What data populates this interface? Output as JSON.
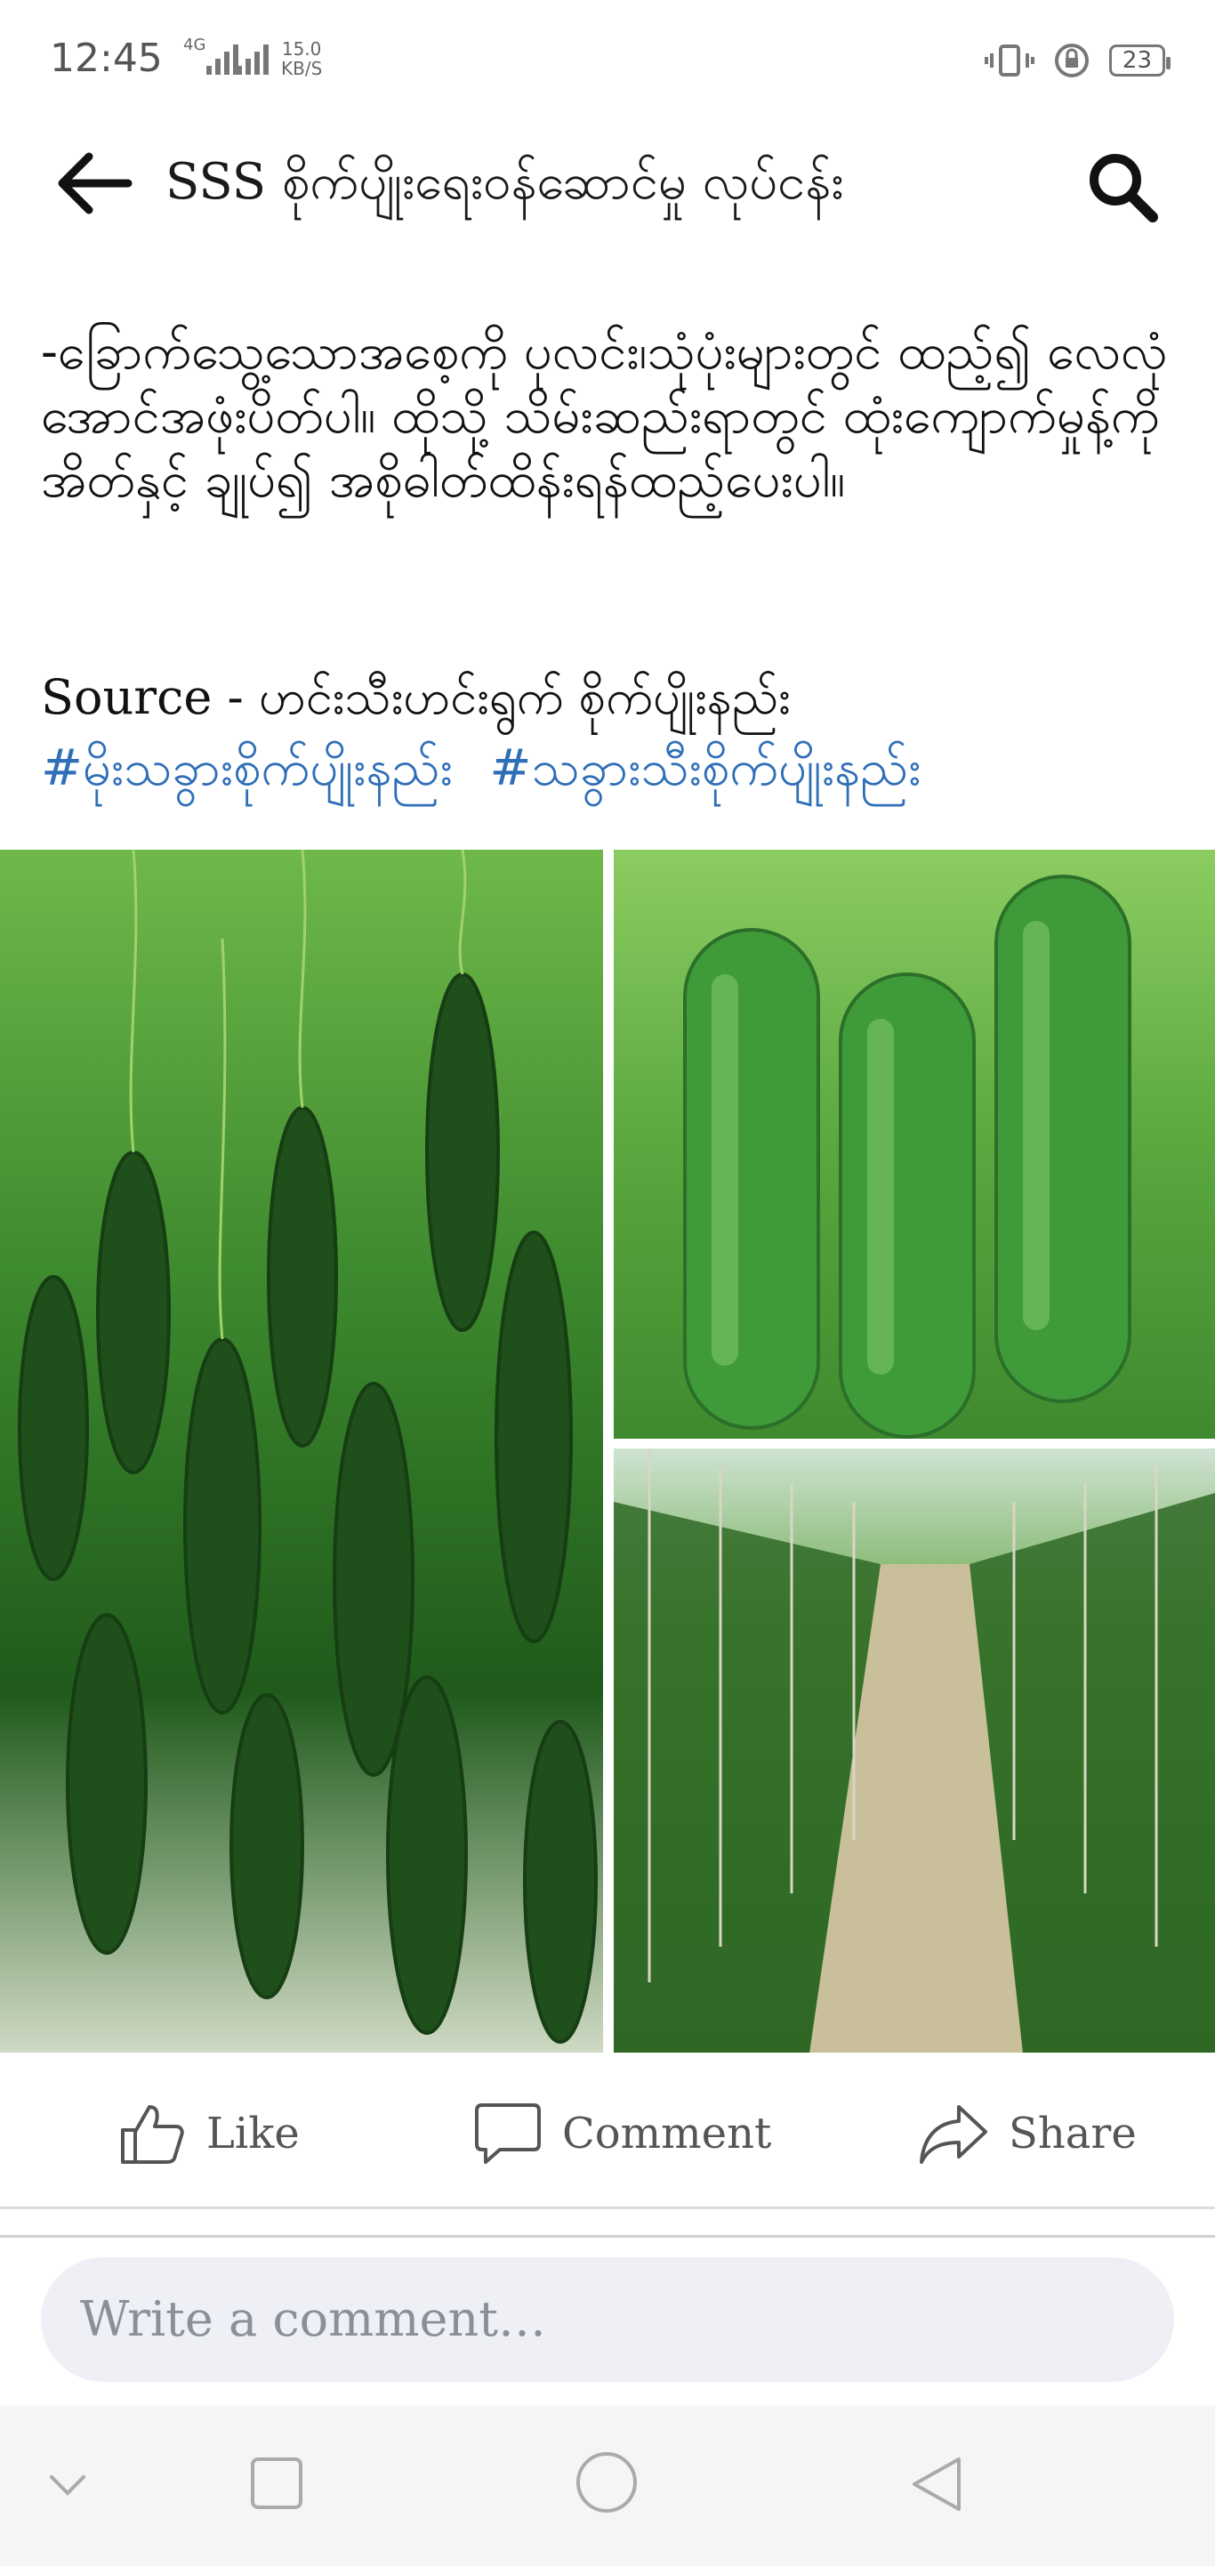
{
  "status_bar": {
    "time": "12:45",
    "network_small": "4G",
    "speed_value": "15.0",
    "speed_unit": "KB/S",
    "battery": "23"
  },
  "header": {
    "title": "SSS စိုက်ပျိုးရေးဝန်ဆောင်မှု လုပ်ငန်း"
  },
  "post": {
    "text": "-ခြောက်သွေ့သောအစေ့ကို ပုလင်း၊သုံပုံးများတွင် ထည့်၍ လေလုံအောင်အဖုံးပိတ်ပါ။ ထိုသို့ သိမ်းဆည်းရာတွင် ထုံးကျောက်မှုန့်ကိုအိတ်နှင့် ချုပ်၍ အစိုဓါတ်ထိန်းရန်ထည့်ပေးပါ။",
    "source": "Source - ဟင်းသီးဟင်းရွက် စိုက်ပျိုးနည်း",
    "hashtags": [
      "#မိုးသခွားစိုက်ပျိုးနည်း",
      "#သခွားသီးစိုက်ပျိုးနည်း"
    ]
  },
  "actions": {
    "like": "Like",
    "comment": "Comment",
    "share": "Share"
  },
  "comment_input": {
    "placeholder": "Write a comment…"
  },
  "colors": {
    "hashtag": "#2f6fb8",
    "comment_bg": "#eef0f5"
  }
}
